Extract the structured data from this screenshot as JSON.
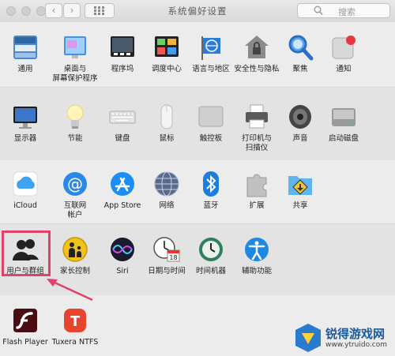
{
  "window": {
    "title": "系统偏好设置",
    "search_placeholder": "搜索",
    "nav_back": "‹",
    "nav_forward": "›"
  },
  "rows": [
    [
      {
        "name": "general",
        "label": "通用",
        "icon": "general-icon"
      },
      {
        "name": "desktop-screensaver",
        "label": "桌面与\n屏幕保护程序",
        "icon": "desktop-screensaver-icon"
      },
      {
        "name": "dock",
        "label": "程序坞",
        "icon": "dock-icon"
      },
      {
        "name": "mission-control",
        "label": "调度中心",
        "icon": "mission-control-icon"
      },
      {
        "name": "language-region",
        "label": "语言与地区",
        "icon": "globe-flag-icon"
      },
      {
        "name": "security-privacy",
        "label": "安全性与隐私",
        "icon": "house-lock-icon"
      },
      {
        "name": "spotlight",
        "label": "聚焦",
        "icon": "magnifier-icon"
      },
      {
        "name": "notifications",
        "label": "通知",
        "icon": "notifications-icon"
      }
    ],
    [
      {
        "name": "displays",
        "label": "显示器",
        "icon": "display-icon"
      },
      {
        "name": "energy-saver",
        "label": "节能",
        "icon": "lightbulb-icon"
      },
      {
        "name": "keyboard",
        "label": "键盘",
        "icon": "keyboard-icon"
      },
      {
        "name": "mouse",
        "label": "鼠标",
        "icon": "mouse-icon"
      },
      {
        "name": "trackpad",
        "label": "触控板",
        "icon": "trackpad-icon"
      },
      {
        "name": "printers-scanners",
        "label": "打印机与\n扫描仪",
        "icon": "printer-icon"
      },
      {
        "name": "sound",
        "label": "声音",
        "icon": "speaker-icon"
      },
      {
        "name": "startup-disk",
        "label": "启动磁盘",
        "icon": "hard-disk-icon"
      }
    ],
    [
      {
        "name": "icloud",
        "label": "iCloud",
        "icon": "cloud-icon"
      },
      {
        "name": "internet-accounts",
        "label": "互联网\n帐户",
        "icon": "at-sign-icon"
      },
      {
        "name": "app-store",
        "label": "App Store",
        "icon": "app-store-icon"
      },
      {
        "name": "network",
        "label": "网络",
        "icon": "network-globe-icon"
      },
      {
        "name": "bluetooth",
        "label": "蓝牙",
        "icon": "bluetooth-icon"
      },
      {
        "name": "extensions",
        "label": "扩展",
        "icon": "puzzle-icon"
      },
      {
        "name": "sharing",
        "label": "共享",
        "icon": "sharing-folder-icon"
      }
    ],
    [
      {
        "name": "users-groups",
        "label": "用户与群组",
        "icon": "users-icon"
      },
      {
        "name": "parental-controls",
        "label": "家长控制",
        "icon": "parental-controls-icon"
      },
      {
        "name": "siri",
        "label": "Siri",
        "icon": "siri-icon"
      },
      {
        "name": "date-time",
        "label": "日期与时间",
        "icon": "clock-calendar-icon"
      },
      {
        "name": "time-machine",
        "label": "时间机器",
        "icon": "time-machine-icon"
      },
      {
        "name": "accessibility",
        "label": "辅助功能",
        "icon": "accessibility-icon"
      }
    ],
    [
      {
        "name": "flash-player",
        "label": "Flash Player",
        "icon": "flash-player-icon"
      },
      {
        "name": "tuxera-ntfs",
        "label": "Tuxera NTFS",
        "icon": "tuxera-icon"
      }
    ]
  ],
  "colors": {
    "highlight": "#e0436a",
    "accent_blue": "#1a7de0"
  },
  "watermark": {
    "text": "锐得游戏网",
    "url": "www.ytruido.com"
  }
}
